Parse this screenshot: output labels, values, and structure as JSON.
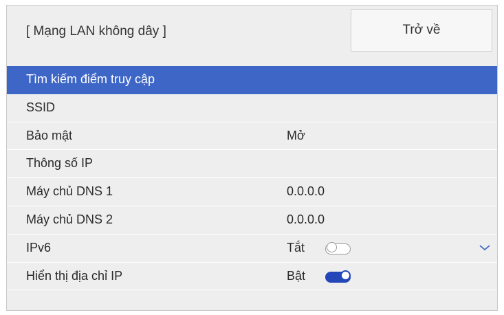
{
  "header": {
    "title": "[ Mạng LAN không dây ]",
    "back_label": "Trở về"
  },
  "menu": [
    {
      "label": "Tìm kiếm điểm truy cập",
      "value": ""
    },
    {
      "label": "SSID",
      "value": ""
    },
    {
      "label": "Bảo mật",
      "value": "Mở"
    },
    {
      "label": "Thông số IP",
      "value": ""
    },
    {
      "label": "Máy chủ DNS 1",
      "value": "0.0.0.0"
    },
    {
      "label": "Máy chủ DNS 2",
      "value": "0.0.0.0"
    },
    {
      "label": "IPv6",
      "value": "Tắt",
      "toggle": "off"
    },
    {
      "label": "Hiển thị địa chỉ IP",
      "value": "Bật",
      "toggle": "on"
    }
  ],
  "colors": {
    "selected_row": "#3d66c6",
    "panel_bg": "#eeeeee",
    "toggle_on": "#2346b8"
  },
  "icons": {
    "scroll_down": "chevron-down-icon"
  }
}
